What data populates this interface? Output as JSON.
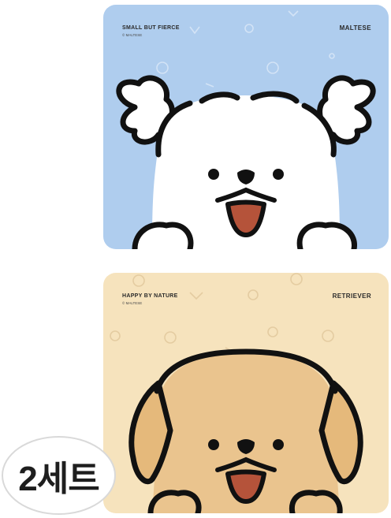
{
  "products": [
    {
      "tagline": "SMALL BUT FIERCE",
      "credit": "© MALTESE",
      "name": "MALTESE",
      "colors": {
        "background": "#afcdee",
        "dog": "#ffffff",
        "mouth": "#b5533a"
      },
      "illustration_icon": "maltese-dog-face"
    },
    {
      "tagline": "HAPPY BY NATURE",
      "credit": "© MALTESE",
      "name": "RETRIEVER",
      "colors": {
        "background": "#f6e3bd",
        "dog": "#eac48e",
        "mouth": "#b5533a"
      },
      "illustration_icon": "retriever-dog-face"
    }
  ],
  "badge": {
    "label": "2세트"
  }
}
